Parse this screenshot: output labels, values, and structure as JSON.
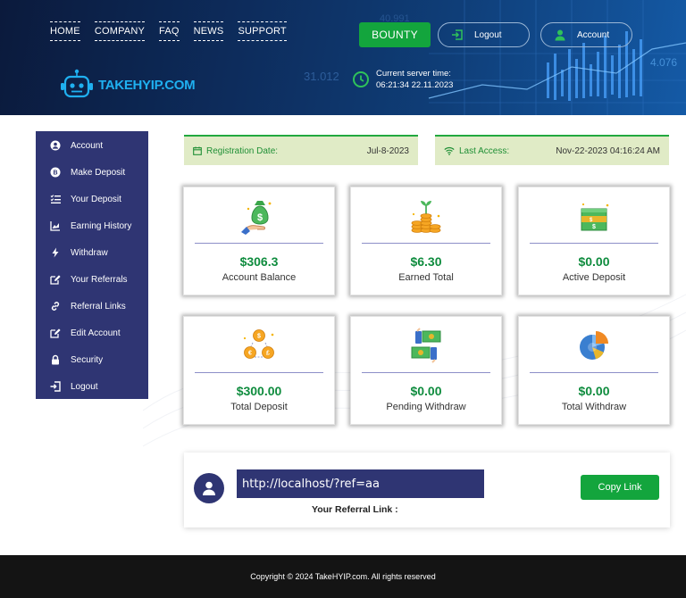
{
  "header": {
    "nav": [
      {
        "label": "HOME"
      },
      {
        "label": "COMPANY"
      },
      {
        "label": "FAQ"
      },
      {
        "label": "NEWS"
      },
      {
        "label": "SUPPORT"
      }
    ],
    "bounty_label": "BOUNTY",
    "logout_label": "Logout",
    "account_label": "Account",
    "logo_text": "TAKEHYIP.COM",
    "server_time_label": "Current server time:",
    "server_time_value": "06:21:34 22.11.2023",
    "bg_numbers": [
      "31.012",
      "40.991",
      "4.076"
    ]
  },
  "sidebar": {
    "items": [
      {
        "label": "Account",
        "icon": "user-circle-icon"
      },
      {
        "label": "Make Deposit",
        "icon": "coin-icon"
      },
      {
        "label": "Your Deposit",
        "icon": "list-check-icon"
      },
      {
        "label": "Earning History",
        "icon": "chart-icon"
      },
      {
        "label": "Withdraw",
        "icon": "bolt-icon"
      },
      {
        "label": "Your Referrals",
        "icon": "edit-icon"
      },
      {
        "label": "Referral Links",
        "icon": "link-icon"
      },
      {
        "label": "Edit Account",
        "icon": "edit-icon"
      },
      {
        "label": "Security",
        "icon": "lock-icon"
      },
      {
        "label": "Logout",
        "icon": "logout-icon"
      }
    ]
  },
  "info": {
    "registration_label": "Registration Date:",
    "registration_value": "Jul-8-2023",
    "last_access_label": "Last Access:",
    "last_access_value": "Nov-22-2023 04:16:24 AM"
  },
  "cards": [
    {
      "amount": "$306.3",
      "label": "Account Balance",
      "icon": "money-bag-hand-icon"
    },
    {
      "amount": "$6.30",
      "label": "Earned Total",
      "icon": "coin-plants-icon"
    },
    {
      "amount": "$0.00",
      "label": "Active Deposit",
      "icon": "cash-stack-icon"
    },
    {
      "amount": "$300.00",
      "label": "Total Deposit",
      "icon": "coin-cycle-icon"
    },
    {
      "amount": "$0.00",
      "label": "Pending Withdraw",
      "icon": "money-exchange-icon"
    },
    {
      "amount": "$0.00",
      "label": "Total Withdraw",
      "icon": "pie-chart-icon"
    }
  ],
  "referral": {
    "link": "http://localhost/?ref=aa",
    "label": "Your Referral Link :",
    "copy_label": "Copy Link"
  },
  "footer": {
    "text": "Copyright © 2024 TakeHYIP.com. All rights reserved"
  },
  "colors": {
    "accent_green": "#13a53d",
    "sidebar_navy": "#2f3573",
    "info_bg": "#e0ebc6",
    "amount_green": "#0f8c3e"
  }
}
